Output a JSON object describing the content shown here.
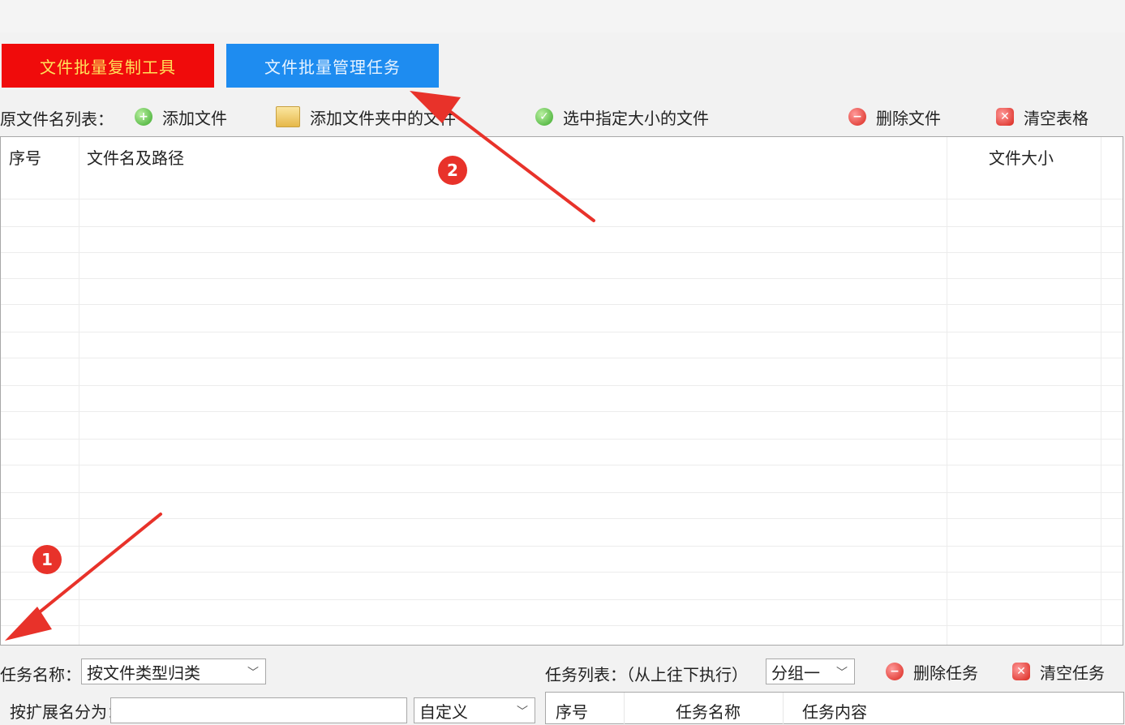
{
  "tabs": {
    "copy_tool": "文件批量复制工具",
    "manage_task": "文件批量管理任务"
  },
  "toolbar": {
    "label": "原文件名列表：",
    "add_file": "添加文件",
    "add_folder_files": "添加文件夹中的文件",
    "select_by_size": "选中指定大小的文件",
    "delete_file": "删除文件",
    "clear_table": "清空表格"
  },
  "file_table": {
    "columns": [
      "序号",
      "文件名及路径",
      "文件大小"
    ]
  },
  "task_panel": {
    "name_label": "任务名称：",
    "name_value": "按文件类型归类",
    "ext_label": "按扩展名分为：",
    "ext_mode_value": "自定义",
    "list_label": "任务列表：（从上往下执行）",
    "group_value": "分组一",
    "delete_task": "删除任务",
    "clear_task": "清空任务",
    "task_columns": [
      "序号",
      "任务名称",
      "任务内容"
    ]
  },
  "annotations": {
    "badge_1": "1",
    "badge_2": "2",
    "arrow_color": "#e8322a"
  },
  "colors": {
    "tab_red": "#f00b0b",
    "tab_blue": "#1e8cf0",
    "badge_red": "#e8322a"
  }
}
